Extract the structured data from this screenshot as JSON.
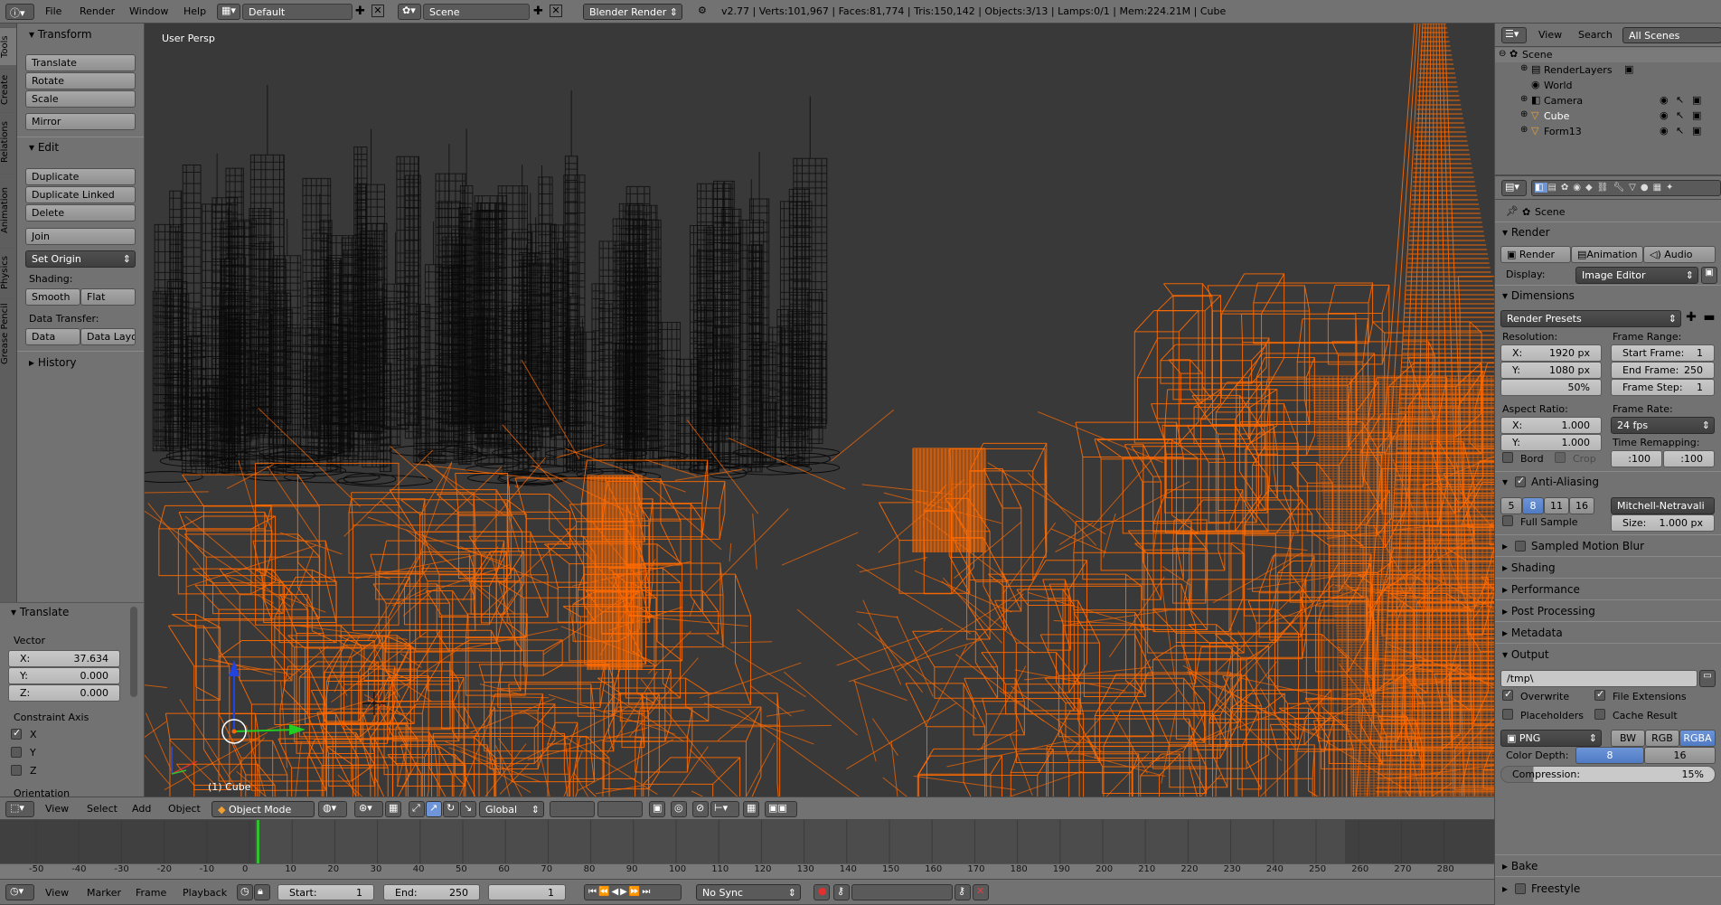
{
  "topbar": {
    "menus": [
      "File",
      "Render",
      "Window",
      "Help"
    ],
    "layout": "Default",
    "scene": "Scene",
    "engine": "Blender Render",
    "stats": "v2.77 | Verts:101,967 | Faces:81,774 | Tris:150,142 | Objects:3/13 | Lamps:0/1 | Mem:224.21M | Cube"
  },
  "tool_tabs": [
    "Tools",
    "Create",
    "Relations",
    "Animation",
    "Physics",
    "Grease Pencil"
  ],
  "tools": {
    "transform_header": "Transform",
    "translate": "Translate",
    "rotate": "Rotate",
    "scale": "Scale",
    "mirror": "Mirror",
    "edit_header": "Edit",
    "duplicate": "Duplicate",
    "duplicate_linked": "Duplicate Linked",
    "delete": "Delete",
    "join": "Join",
    "set_origin": "Set Origin",
    "shading_label": "Shading:",
    "smooth": "Smooth",
    "flat": "Flat",
    "data_transfer_label": "Data Transfer:",
    "data": "Data",
    "data_layout": "Data Layo",
    "history_header": "History"
  },
  "operator": {
    "header": "Translate",
    "vector_label": "Vector",
    "x_label": "X:",
    "x_value": "37.634",
    "y_label": "Y:",
    "y_value": "0.000",
    "z_label": "Z:",
    "z_value": "0.000",
    "constraint_label": "Constraint Axis",
    "axes": [
      "X",
      "Y",
      "Z"
    ],
    "orientation_label": "Orientation"
  },
  "viewport": {
    "view_label": "User Persp",
    "object_label": "(1) Cube",
    "wire_color": "#ff6a00",
    "bg_color": "#393939"
  },
  "view3d_header": {
    "menus": [
      "View",
      "Select",
      "Add",
      "Object"
    ],
    "mode": "Object Mode",
    "orientation": "Global"
  },
  "timeline": {
    "ticks": [
      "-50",
      "-40",
      "-30",
      "-20",
      "-10",
      "0",
      "10",
      "20",
      "30",
      "40",
      "50",
      "60",
      "70",
      "80",
      "90",
      "100",
      "110",
      "120",
      "130",
      "140",
      "150",
      "160",
      "170",
      "180",
      "190",
      "200",
      "210",
      "220",
      "230",
      "240",
      "250",
      "260",
      "270",
      "280"
    ],
    "menus": [
      "View",
      "Marker",
      "Frame",
      "Playback"
    ],
    "start_label": "Start:",
    "start_value": "1",
    "end_label": "End:",
    "end_value": "250",
    "current": "1",
    "sync": "No Sync"
  },
  "outliner": {
    "menus": [
      "View",
      "Search"
    ],
    "filter": "All Scenes",
    "items": [
      "Scene",
      "RenderLayers",
      "World",
      "Camera",
      "Cube",
      "Form13"
    ]
  },
  "properties": {
    "breadcrumb": "Scene",
    "render_header": "Render",
    "render_btn": "Render",
    "animation_btn": "Animation",
    "audio_btn": "Audio",
    "display_label": "Display:",
    "display_value": "Image Editor",
    "dimensions_header": "Dimensions",
    "render_presets": "Render Presets",
    "resolution_label": "Resolution:",
    "res_x_label": "X:",
    "res_x": "1920 px",
    "res_y_label": "Y:",
    "res_y": "1080 px",
    "res_pct": "50%",
    "frame_range_label": "Frame Range:",
    "start_frame_label": "Start Frame:",
    "start_frame": "1",
    "end_frame_label": "End Frame:",
    "end_frame": "250",
    "frame_step_label": "Frame Step:",
    "frame_step": "1",
    "aspect_label": "Aspect Ratio:",
    "asp_x_label": "X:",
    "asp_x": "1.000",
    "asp_y_label": "Y:",
    "asp_y": "1.000",
    "frame_rate_label": "Frame Rate:",
    "fps": "24 fps",
    "time_remap_label": "Time Remapping:",
    "remap_old": ":100",
    "remap_new": ":100",
    "border": "Bord",
    "crop": "Crop",
    "aa_header": "Anti-Aliasing",
    "aa_samples": [
      "5",
      "8",
      "11",
      "16"
    ],
    "aa_filter": "Mitchell-Netravali",
    "full_sample": "Full Sample",
    "size_label": "Size:",
    "size_value": "1.000 px",
    "sampled_motion_blur": "Sampled Motion Blur",
    "shading": "Shading",
    "performance": "Performance",
    "post_processing": "Post Processing",
    "metadata": "Metadata",
    "output_header": "Output",
    "output_path": "/tmp\\",
    "overwrite": "Overwrite",
    "file_extensions": "File Extensions",
    "placeholders": "Placeholders",
    "cache_result": "Cache Result",
    "format": "PNG",
    "bw": "BW",
    "rgb": "RGB",
    "rgba": "RGBA",
    "color_depth_label": "Color Depth:",
    "depth_8": "8",
    "depth_16": "16",
    "compression_label": "Compression:",
    "compression_value": "15%",
    "bake": "Bake",
    "freestyle": "Freestyle"
  }
}
